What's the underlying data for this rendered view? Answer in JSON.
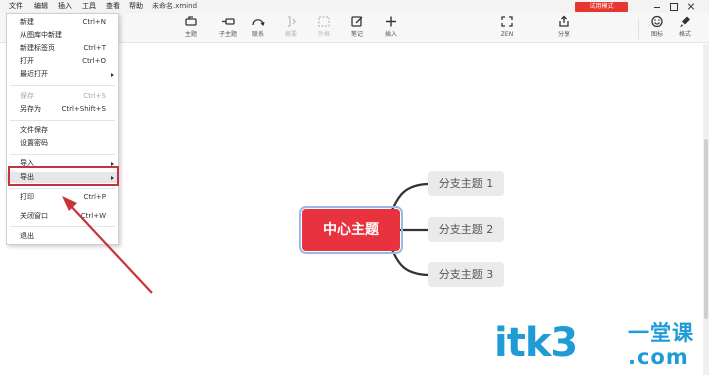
{
  "menubar": {
    "items": [
      "文件",
      "编辑",
      "插入",
      "工具",
      "查看",
      "帮助"
    ],
    "doc_title": "未命名.xmind",
    "trial_label": "试用模式"
  },
  "toolbar": {
    "topic": "主题",
    "subtopic": "子主题",
    "relation": "联系",
    "summary": "概要",
    "boundary": "外框",
    "note": "笔记",
    "insert": "插入",
    "zen": "ZEN",
    "share": "分享",
    "icon": "图标",
    "format": "格式"
  },
  "file_menu": {
    "items": [
      {
        "label": "新建",
        "shortcut": "Ctrl+N"
      },
      {
        "label": "从图库中新建",
        "shortcut": ""
      },
      {
        "label": "新建标签页",
        "shortcut": "Ctrl+T"
      },
      {
        "label": "打开",
        "shortcut": "Ctrl+O"
      },
      {
        "label": "最近打开",
        "shortcut": ""
      },
      {
        "label": "保存",
        "shortcut": "Ctrl+S"
      },
      {
        "label": "另存为",
        "shortcut": "Ctrl+Shift+S"
      },
      {
        "label": "文件保存",
        "shortcut": ""
      },
      {
        "label": "设置密码",
        "shortcut": ""
      },
      {
        "label": "导入",
        "shortcut": ""
      },
      {
        "label": "导出",
        "shortcut": ""
      },
      {
        "label": "打印",
        "shortcut": "Ctrl+P"
      },
      {
        "label": "关闭窗口",
        "shortcut": "Ctrl+W"
      },
      {
        "label": "退出",
        "shortcut": ""
      }
    ]
  },
  "mindmap": {
    "central": "中心主题",
    "branches": [
      "分支主题 1",
      "分支主题 2",
      "分支主题 3"
    ]
  },
  "watermark": {
    "main": "itk3",
    "cn": "一堂课",
    "dotcom": ".com"
  },
  "colors": {
    "central": "#e8323d",
    "highlight": "#c8323a",
    "trial": "#e5362f",
    "watermark": "#1f9bd6"
  }
}
